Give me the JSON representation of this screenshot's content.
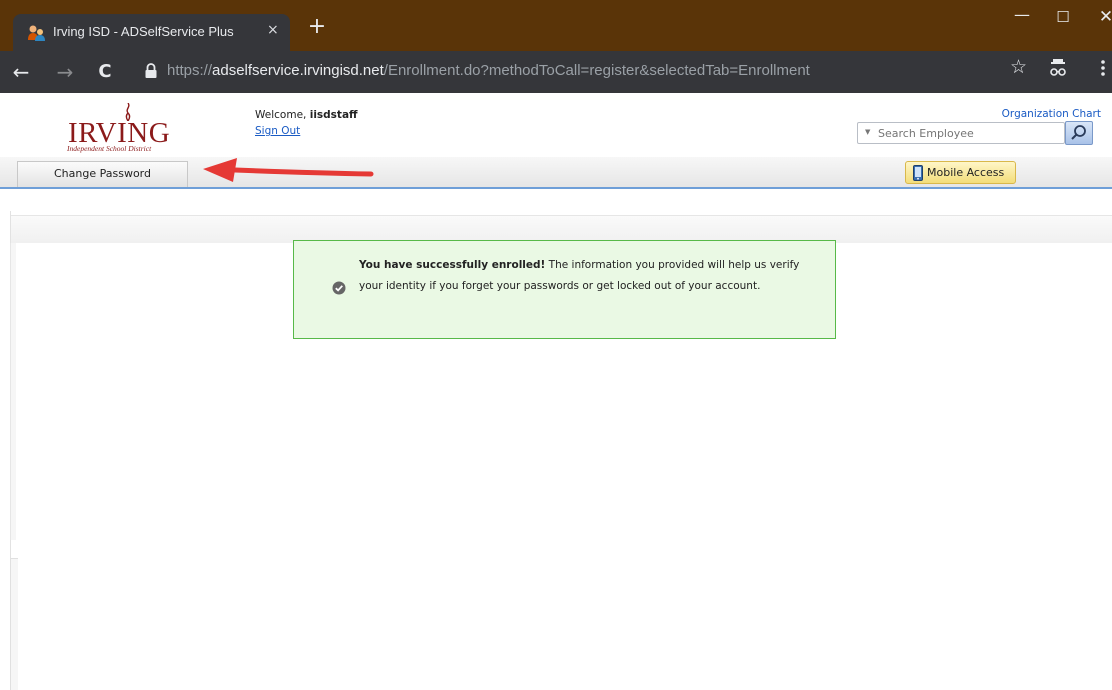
{
  "browser": {
    "tab_title": "Irving ISD - ADSelfService Plus",
    "tab_close": "×",
    "new_tab": "+",
    "url_scheme": "https://",
    "url_host": "adselfservice.irvingisd.net",
    "url_path": "/Enrollment.do?methodToCall=register&selectedTab=Enrollment",
    "window_min": "—",
    "window_max": "☐",
    "window_close": "✕",
    "back": "←",
    "forward": "→",
    "reload": "C",
    "star": "☆"
  },
  "header": {
    "logo_word": "IRVING",
    "logo_sub": "Independent School District",
    "welcome_prefix": "Welcome, ",
    "username": "iisdstaff",
    "sign_out": "Sign Out",
    "org_chart": "Organization Chart",
    "search_placeholder": "Search Employee"
  },
  "tabs": {
    "change_password": "Change Password",
    "mobile_access": "Mobile Access"
  },
  "message": {
    "strong": "You have successfully enrolled!",
    "body": " The information you provided will help us verify your identity if you forget your passwords or get locked out of your account."
  },
  "colors": {
    "titlebar": "#5a3408",
    "success_bg": "#eaf9e4",
    "success_border": "#57b948",
    "annotation_arrow": "#e53935",
    "brand": "#8b1a1a"
  }
}
